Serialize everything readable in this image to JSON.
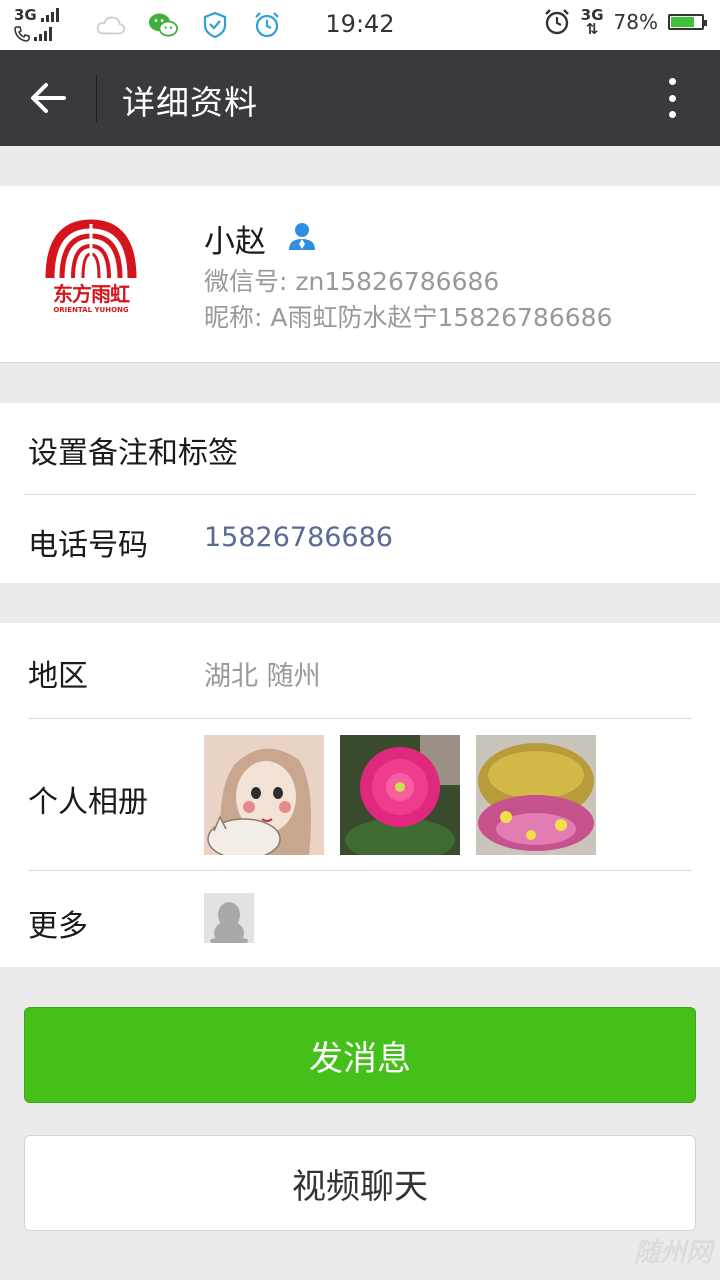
{
  "status_bar": {
    "network_top": "3G",
    "time": "19:42",
    "right_network": "3G",
    "battery_percent": "78%",
    "battery_level": 0.78
  },
  "header": {
    "title": "详细资料"
  },
  "profile": {
    "name": "小赵",
    "wechat_id": "微信号: zn15826786686",
    "nickname": "昵称: A雨虹防水赵宁15826786686",
    "avatar_logo_text": "东方雨虹",
    "avatar_logo_subtext": "ORIENTAL YUHONG"
  },
  "rows": {
    "remark_label": "设置备注和标签",
    "phone_label": "电话号码",
    "phone_value": "15826786686",
    "region_label": "地区",
    "region_value": "湖北  随州",
    "album_label": "个人相册",
    "more_label": "更多"
  },
  "actions": {
    "send_message": "发消息",
    "video_chat": "视频聊天"
  },
  "watermark": "随州网",
  "colors": {
    "header_bg": "#393a3f",
    "send_button": "#45c01a",
    "phone_link": "#576b95",
    "secondary_text": "#999999"
  }
}
